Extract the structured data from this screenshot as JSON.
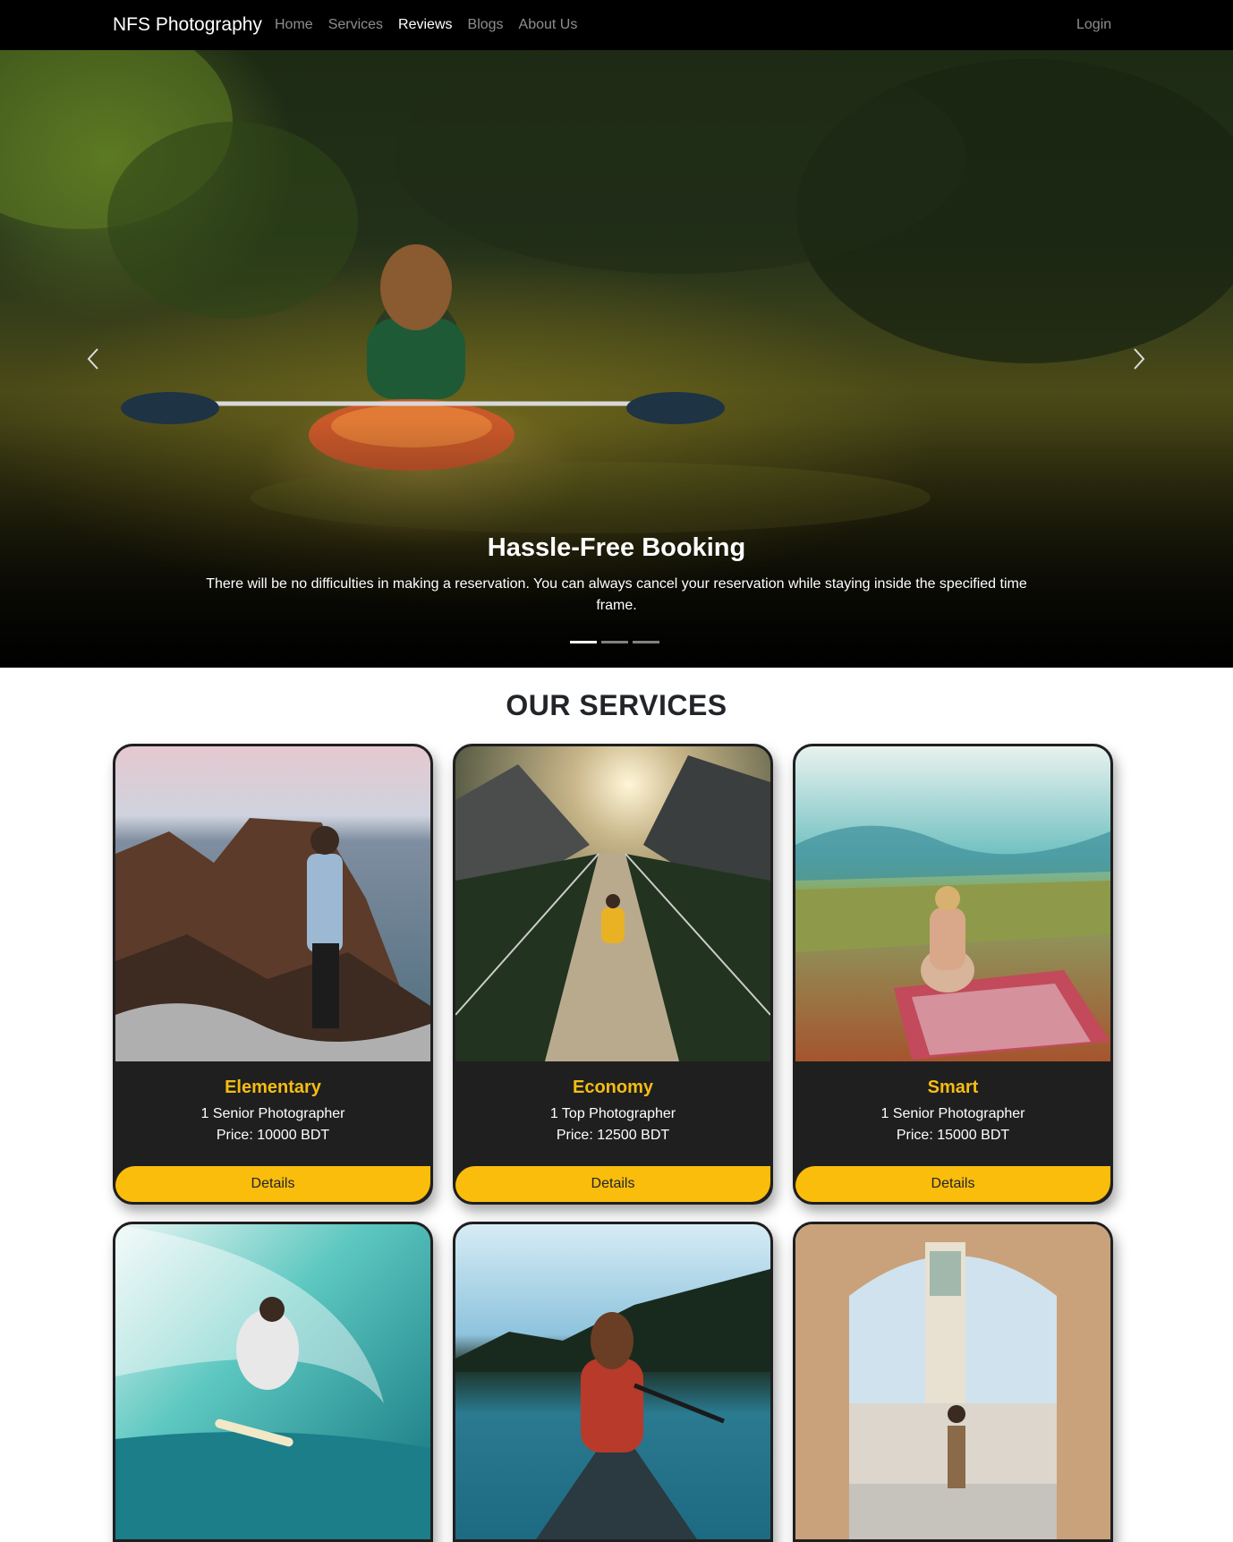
{
  "navbar": {
    "brand": "NFS Photography",
    "links": [
      "Home",
      "Services",
      "Reviews",
      "Blogs",
      "About Us"
    ],
    "active_link": "Reviews",
    "login": "Login"
  },
  "hero": {
    "title": "Hassle-Free Booking",
    "text": "There will be no difficulties in making a reservation. You can always cancel your reservation while staying inside the specified time frame.",
    "slide_count": 3,
    "active_slide": 1,
    "prev_icon": "chevron-left-icon",
    "next_icon": "chevron-right-icon"
  },
  "services": {
    "heading": "OUR SERVICES",
    "cards": [
      {
        "title": "Elementary",
        "line1": "1 Senior Photographer",
        "line2": "Price: 10000 BDT",
        "button": "Details"
      },
      {
        "title": "Economy",
        "line1": "1 Top Photographer",
        "line2": "Price: 12500 BDT",
        "button": "Details"
      },
      {
        "title": "Smart",
        "line1": "1 Senior Photographer",
        "line2": "Price: 15000 BDT",
        "button": "Details"
      }
    ]
  },
  "colors": {
    "navbar_bg": "#000000",
    "card_bg": "#1f1f1f",
    "accent": "#fbbd0b",
    "card_title": "#f5bd13"
  }
}
